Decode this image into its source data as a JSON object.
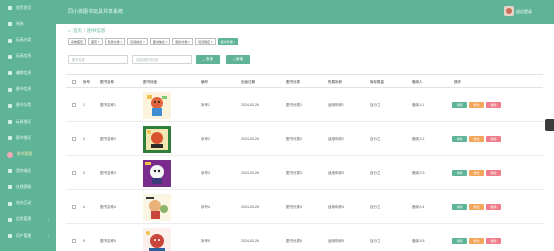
{
  "app": {
    "title": "同小孩图书玩具共享系统",
    "user_name": "退出登录"
  },
  "sidebar": {
    "items": [
      {
        "label": "首页首页",
        "icon": "home-icon"
      },
      {
        "label": "系统",
        "icon": "gear-icon"
      },
      {
        "label": "玩具分类",
        "icon": "grid-icon"
      },
      {
        "label": "玩具信息",
        "icon": "cube-icon"
      },
      {
        "label": "编辑信息",
        "icon": "edit-icon"
      },
      {
        "label": "图书信息",
        "icon": "book-icon"
      },
      {
        "label": "图书分类",
        "icon": "folder-icon"
      },
      {
        "label": "玩具借还",
        "icon": "swap-icon"
      },
      {
        "label": "图书借还",
        "icon": "swap-icon"
      },
      {
        "label": "图书管理",
        "icon": "book-icon",
        "active": true
      },
      {
        "label": "我的借还",
        "icon": "list-icon"
      },
      {
        "label": "在线客服",
        "icon": "chat-icon"
      },
      {
        "label": "站内互动",
        "icon": "message-icon"
      },
      {
        "label": "信息管理",
        "icon": "info-icon"
      },
      {
        "label": "用户管理",
        "icon": "user-icon"
      }
    ]
  },
  "breadcrumb": {
    "home": "首页",
    "separator": "/",
    "current": "图书信息"
  },
  "tags": [
    "系统首页",
    "首页",
    "玩具分类",
    "玩具信息",
    "图书信息",
    "图书分类",
    "玩具借还",
    "图书管理"
  ],
  "toolbar": {
    "search1_placeholder": "图书名称",
    "search2_placeholder": "请选择图书分类",
    "query_label": "查询",
    "add_label": "新增"
  },
  "table": {
    "columns": [
      "序号",
      "图书名称",
      "图书封面",
      "编号",
      "出版日期",
      "图书分类",
      "所属年龄",
      "库存数量",
      "借阅人",
      "操作"
    ],
    "rows": [
      {
        "index": "1",
        "name": "图书名称1",
        "code": "序号1",
        "date": "2024-03-26",
        "category": "图书分类1",
        "age": "适用年龄1",
        "stock": "百分之",
        "person": "借阅人1"
      },
      {
        "index": "2",
        "name": "图书名称2",
        "code": "序号2",
        "date": "2024-03-26",
        "category": "图书分类2",
        "age": "适用年龄2",
        "stock": "百分之",
        "person": "借阅人2"
      },
      {
        "index": "3",
        "name": "图书名称3",
        "code": "序号3",
        "date": "2024-03-26",
        "category": "图书分类3",
        "age": "适用年龄3",
        "stock": "百分之",
        "person": "借阅人3"
      },
      {
        "index": "4",
        "name": "图书名称4",
        "code": "序号4",
        "date": "2024-03-26",
        "category": "图书分类4",
        "age": "适用年龄4",
        "stock": "百分之",
        "person": "借阅人4"
      },
      {
        "index": "5",
        "name": "图书名称5",
        "code": "序号5",
        "date": "2024-03-26",
        "category": "图书分类5",
        "age": "适用年龄5",
        "stock": "百分之",
        "person": "借阅人5"
      }
    ],
    "actions": {
      "detail": "详情",
      "edit": "修改",
      "delete": "删除"
    }
  },
  "colors": {
    "accent": "#5fb497",
    "edit": "#f2a65a",
    "delete": "#ef7c8a"
  }
}
